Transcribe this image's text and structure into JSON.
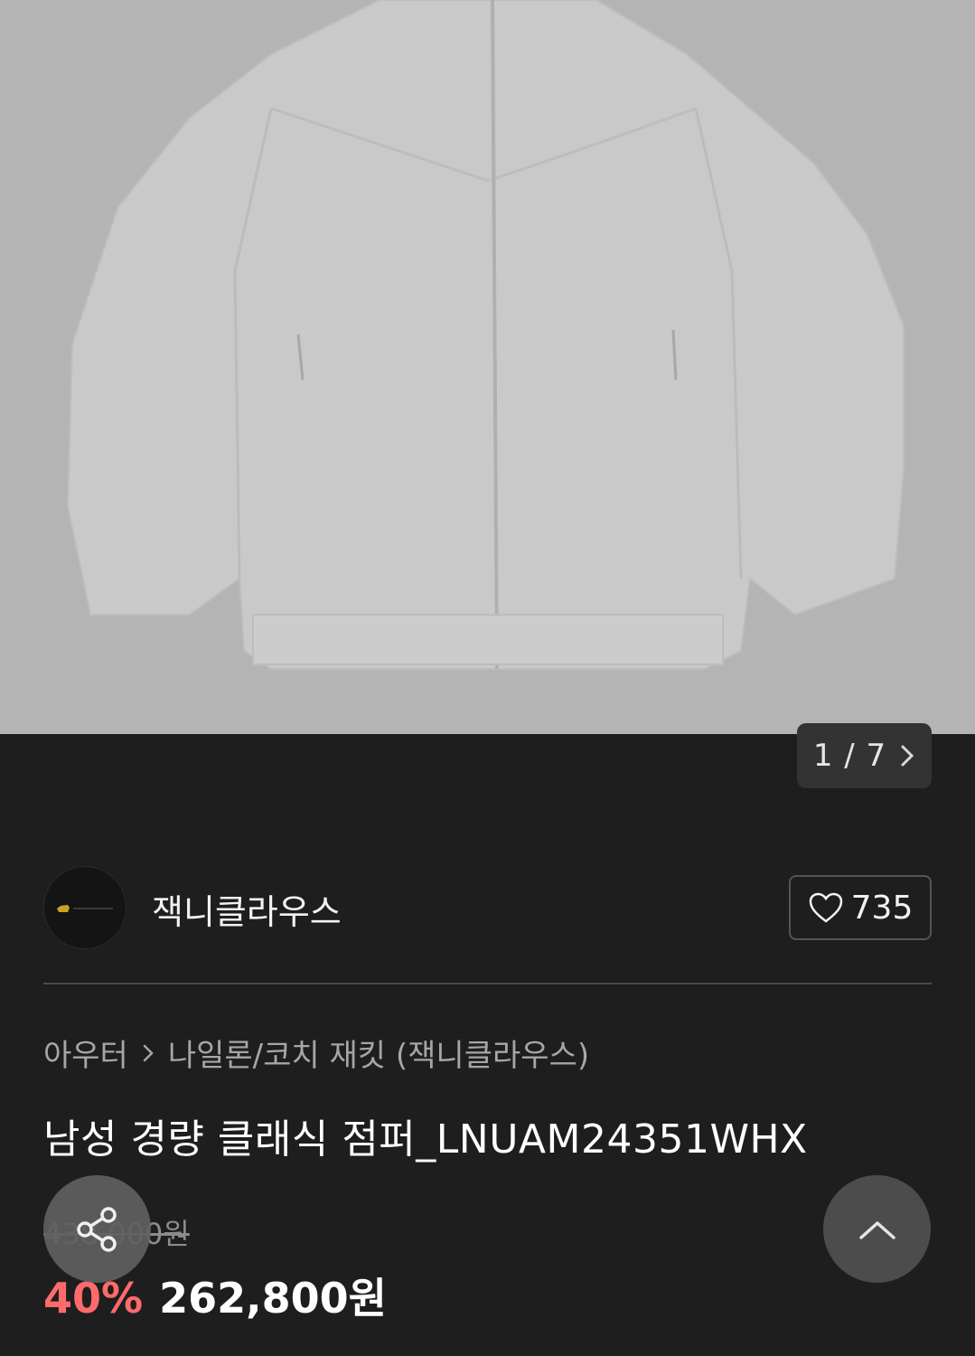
{
  "gallery": {
    "image_alt": "jacket-product-photo",
    "counter": "1 / 7",
    "next_icon": "chevron-right-icon"
  },
  "brand": {
    "name": "잭니클라우스",
    "logo_icon": "brand-logo-bear",
    "like_icon": "heart-outline-icon",
    "like_count": "735"
  },
  "breadcrumb": {
    "items": [
      "아우터",
      "나일론/코치 재킷 (잭니클라우스)"
    ],
    "separator_icon": "chevron-right-icon"
  },
  "product": {
    "title": "남성 경량 클래식 점퍼_LNUAM24351WHX",
    "original_price": "438,000원",
    "discount": "40%",
    "sale_price": "262,800원"
  },
  "floating": {
    "share_icon": "share-icon",
    "top_icon": "chevron-up-icon"
  },
  "colors": {
    "background": "#1e1e1e",
    "discount": "#ff6b6b",
    "image_bg": "#b4b4b4"
  }
}
